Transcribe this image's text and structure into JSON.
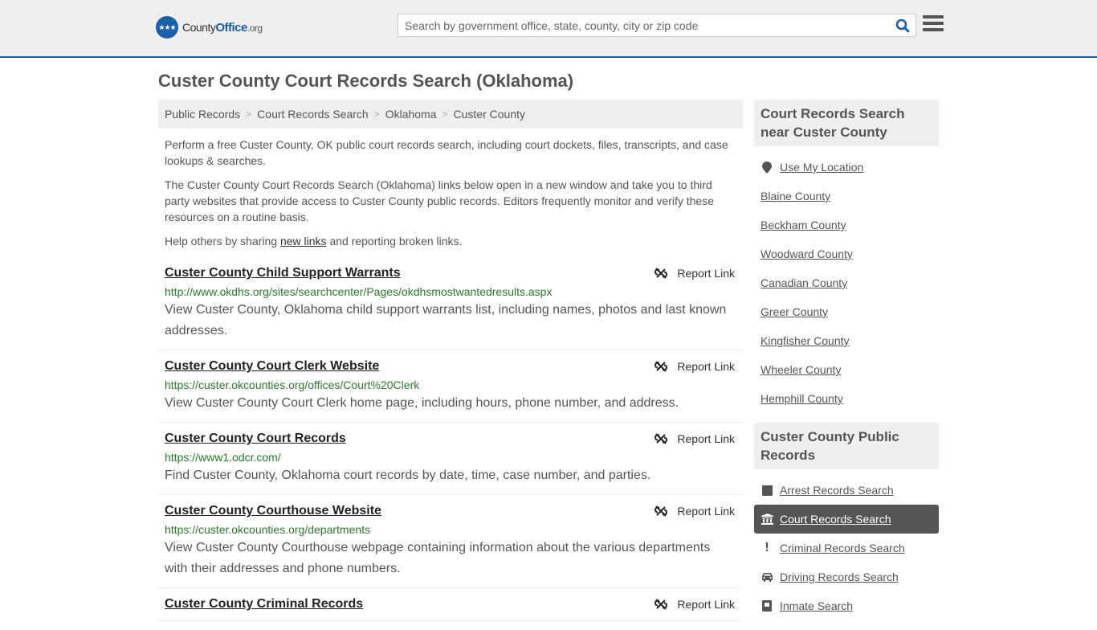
{
  "header": {
    "logo_badge": "★★★",
    "logo_county": "County",
    "logo_office": "Office",
    "logo_org": ".org",
    "search_placeholder": "Search by government office, state, county, city or zip code",
    "search_value": ""
  },
  "page_title": "Custer County Court Records Search (Oklahoma)",
  "breadcrumb": [
    "Public Records",
    "Court Records Search",
    "Oklahoma",
    "Custer County"
  ],
  "intro": {
    "p1": "Perform a free Custer County, OK public court records search, including court dockets, files, transcripts, and case lookups & searches.",
    "p2": "The Custer County Court Records Search (Oklahoma) links below open in a new window and take you to third party websites that provide access to Custer County public records. Editors frequently monitor and verify these resources on a routine basis.",
    "p3_before": "Help others by sharing ",
    "p3_link": "new links",
    "p3_after": " and reporting broken links."
  },
  "report_label": "Report Link",
  "results": [
    {
      "title": "Custer County Child Support Warrants",
      "url": "http://www.okdhs.org/sites/searchcenter/Pages/okdhsmostwantedresults.aspx",
      "desc": "View Custer County, Oklahoma child support warrants list, including names, photos and last known addresses."
    },
    {
      "title": "Custer County Court Clerk Website",
      "url": "https://custer.okcounties.org/offices/Court%20Clerk",
      "desc": "View Custer County Court Clerk home page, including hours, phone number, and address."
    },
    {
      "title": "Custer County Court Records",
      "url": "https://www1.odcr.com/",
      "desc": "Find Custer County, Oklahoma court records by date, time, case number, and parties."
    },
    {
      "title": "Custer County Courthouse Website",
      "url": "https://custer.okcounties.org/departments",
      "desc": "View Custer County Courthouse webpage containing information about the various departments with their addresses and phone numbers."
    },
    {
      "title": "Custer County Criminal Records",
      "url": "",
      "desc": ""
    }
  ],
  "sidebar": {
    "nearby_title": "Court Records Search near Custer County",
    "use_location": "Use My Location",
    "nearby": [
      "Blaine County",
      "Beckham County",
      "Woodward County",
      "Canadian County",
      "Greer County",
      "Kingfisher County",
      "Wheeler County",
      "Hemphill County"
    ],
    "public_title": "Custer County Public Records",
    "public_records": [
      {
        "label": "Arrest Records Search",
        "icon": "square-icon",
        "active": false
      },
      {
        "label": "Court Records Search",
        "icon": "courthouse-icon",
        "active": true
      },
      {
        "label": "Criminal Records Search",
        "icon": "exclamation-icon",
        "active": false
      },
      {
        "label": "Driving Records Search",
        "icon": "car-icon",
        "active": false
      },
      {
        "label": "Inmate Search",
        "icon": "inmate-icon",
        "active": false
      }
    ]
  },
  "colors": {
    "brand_blue": "#1a5fa8",
    "url_green": "#2a7a2a",
    "active_bg": "#555555"
  }
}
